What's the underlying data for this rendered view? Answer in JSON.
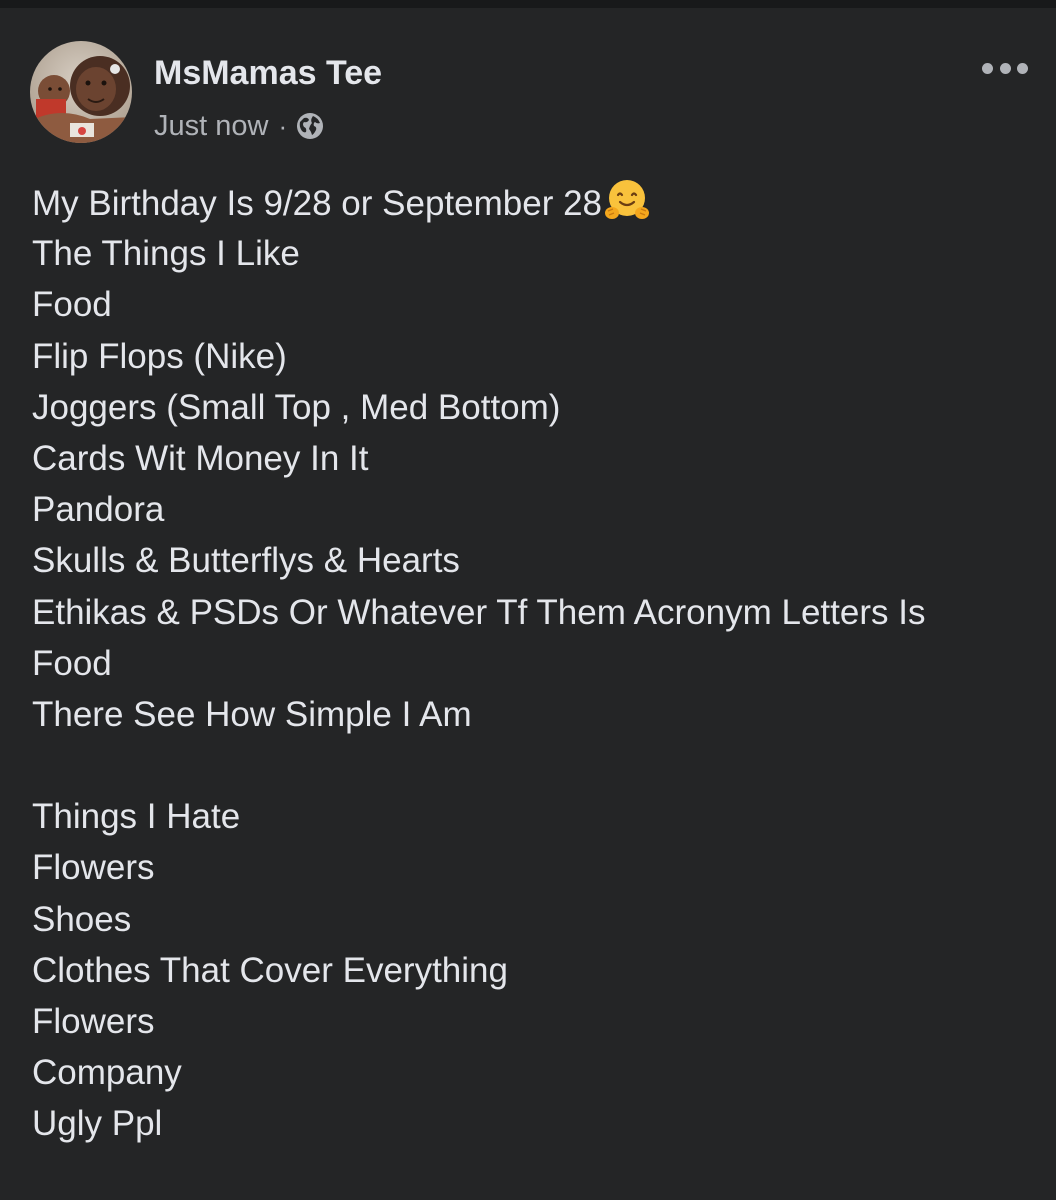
{
  "post": {
    "author": "MsMamas Tee",
    "timestamp": "Just now",
    "separator": "·",
    "privacy_icon": "globe-icon",
    "menu_icon": "more-options-icon",
    "line_1": "My Birthday Is 9/28 or September 28",
    "line_1_emoji": "hugging-face-icon",
    "line_2": "The Things I Like",
    "line_3": "Food",
    "line_4": "Flip Flops (Nike)",
    "line_5": "Joggers (Small Top , Med Bottom)",
    "line_6": "Cards Wit Money In It",
    "line_7": "Pandora",
    "line_8": "Skulls & Butterflys & Hearts",
    "line_9": "Ethikas & PSDs Or Whatever Tf Them Acronym Letters Is",
    "line_10": "Food",
    "line_11": "There See How Simple I Am",
    "line_12": "Things I Hate",
    "line_13": "Flowers",
    "line_14": "Shoes",
    "line_15": "Clothes That Cover Everything",
    "line_16": "Flowers",
    "line_17": "Company",
    "line_18": "Ugly Ppl"
  },
  "colors": {
    "background": "#242526",
    "primary_text": "#e4e6eb",
    "secondary_text": "#b0b3b8"
  }
}
